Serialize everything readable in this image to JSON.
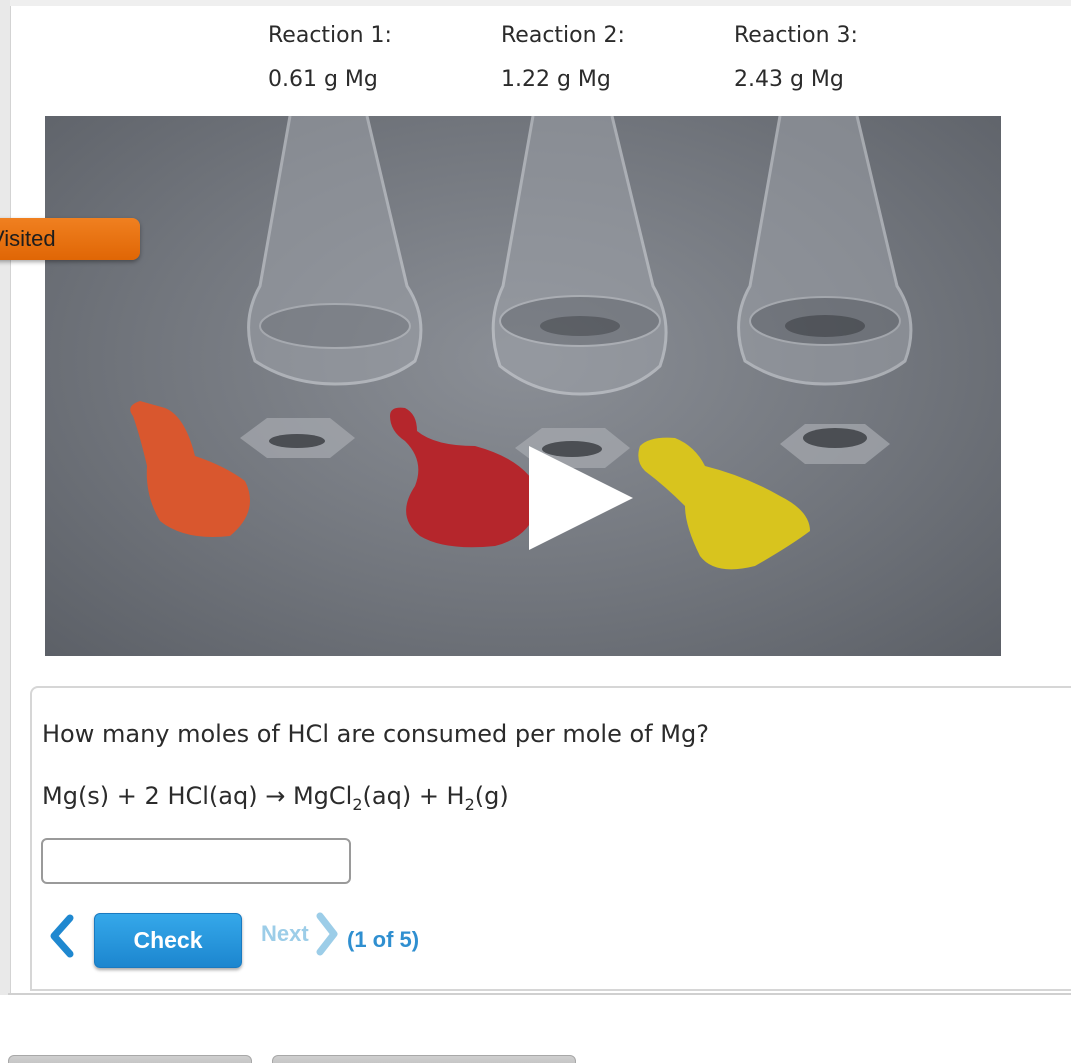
{
  "reactions": [
    {
      "label": "Reaction 1:",
      "mass": "0.61 g Mg"
    },
    {
      "label": "Reaction 2:",
      "mass": "1.22 g Mg"
    },
    {
      "label": "Reaction 3:",
      "mass": "2.43 g Mg"
    }
  ],
  "visited_tab": {
    "label": "Visited"
  },
  "question": {
    "prompt": "How many moles of HCl are consumed per mole of Mg?",
    "equation": {
      "reactants": "Mg(s) + 2 HCl(aq) ",
      "arrow": "→",
      "product1_a": " MgCl",
      "product1_sub": "2",
      "product1_b": "(aq) + H",
      "product2_sub": "2",
      "product2_b": "(g)"
    },
    "answer_value": "",
    "answer_placeholder": ""
  },
  "nav": {
    "check_label": "Check",
    "next_label": "Next",
    "page_count": "(1 of 5)"
  },
  "colors": {
    "visited_tab": "#e86e10",
    "check_button": "#2596dd",
    "next_disabled": "#9ccde8",
    "page_count": "#2f8fd0"
  },
  "icons": {
    "prev": "chevron-left-icon",
    "next": "chevron-right-icon",
    "play": "play-icon"
  }
}
